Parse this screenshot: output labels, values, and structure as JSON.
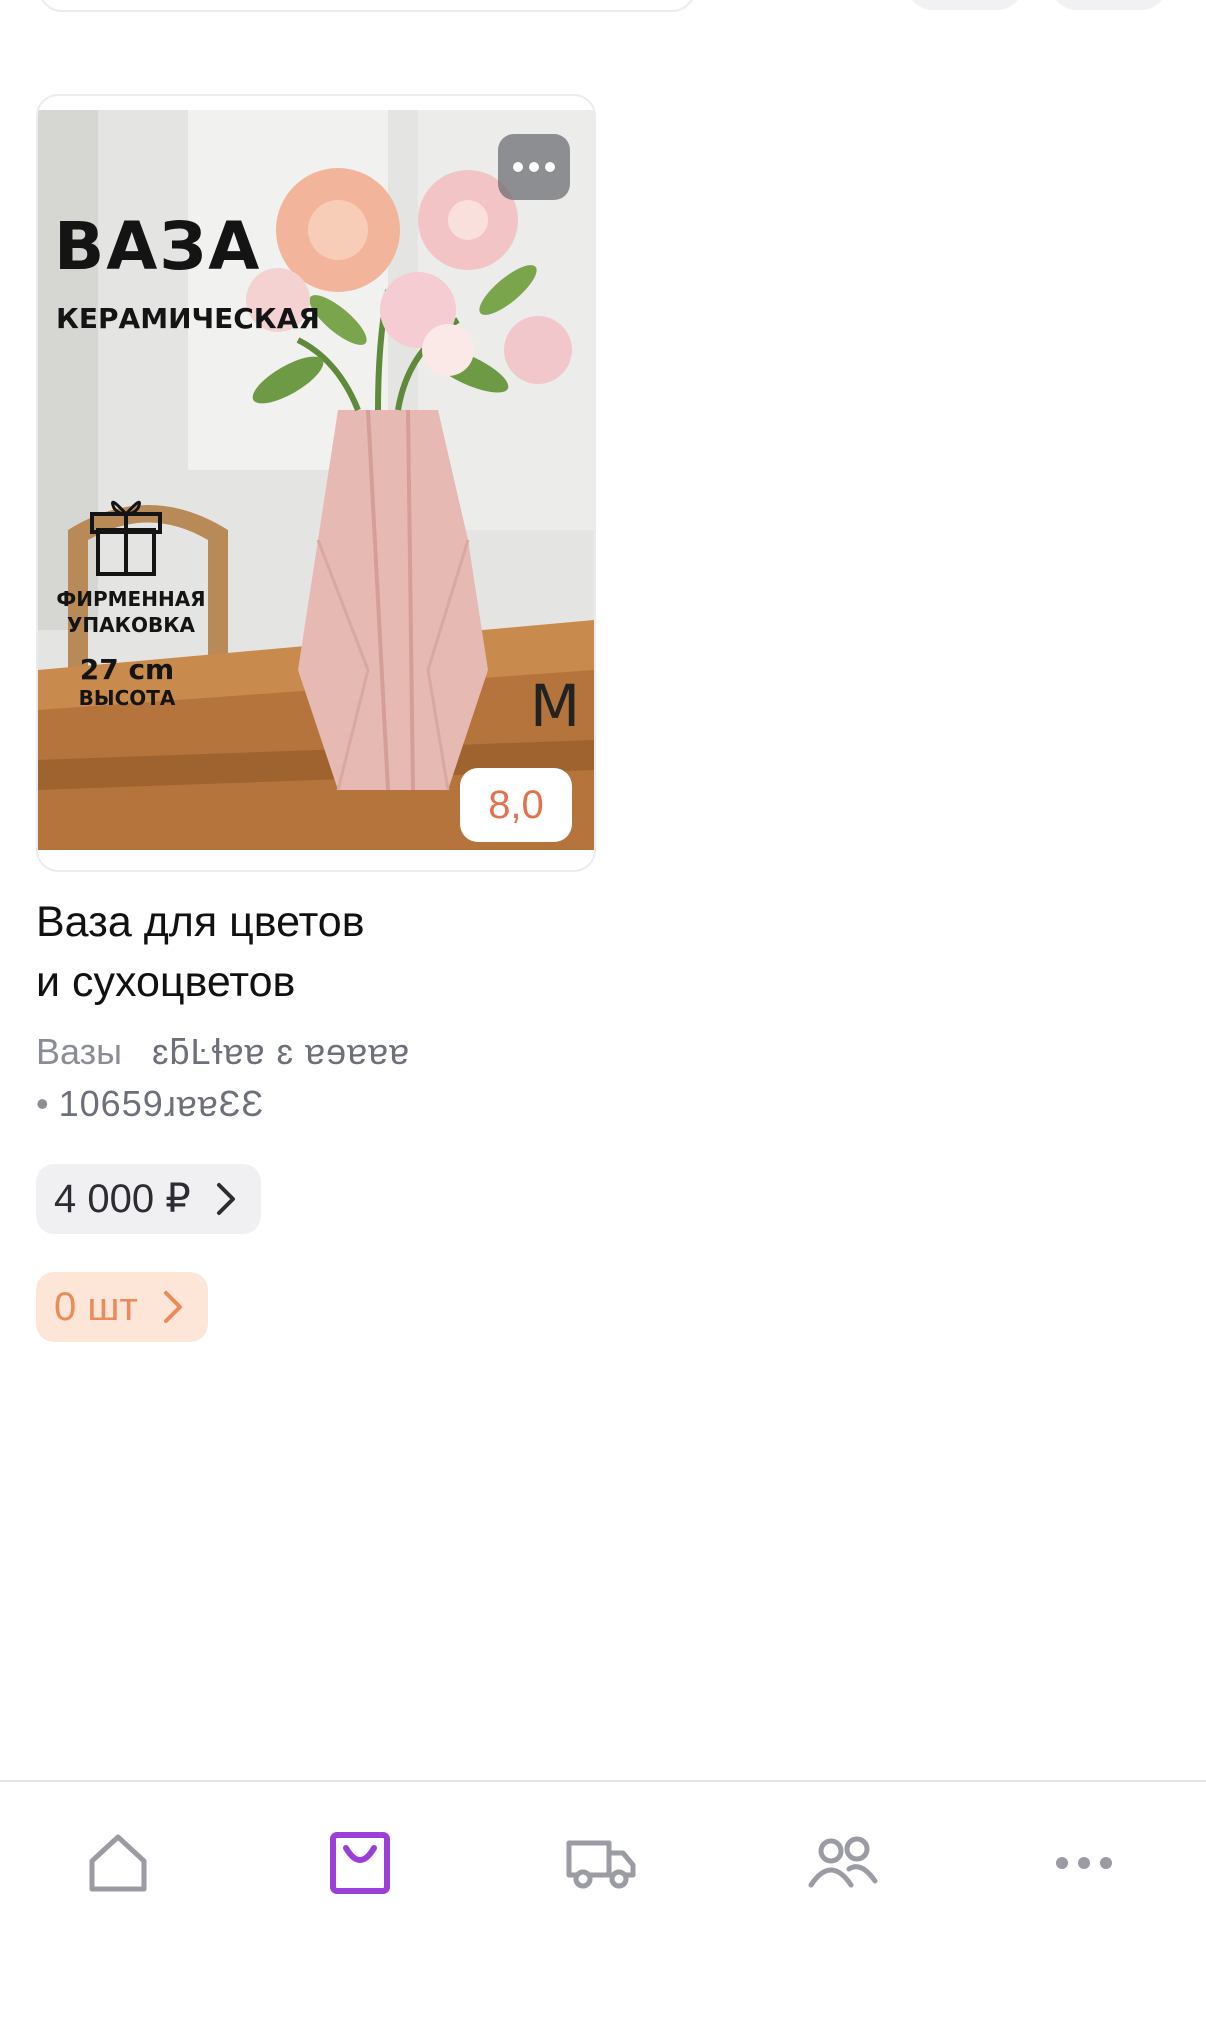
{
  "product": {
    "title_line1": "Ваза для цветов",
    "title_line2": "и сухоцветов",
    "category": "Вазы",
    "seller_obscured": "ɛƃĿɬɐɐ ɛ ɐɘɐɐɐ",
    "article_bullet": "•",
    "article": "10659ɹɐɐƐƐ",
    "price": "4 000 ₽",
    "quantity": "0 шт",
    "rating": "8,0",
    "image_text": {
      "title": "ВАЗА",
      "subtitle": "КЕРАМИЧЕСКАЯ",
      "packaging_line1": "ФИРМЕННАЯ",
      "packaging_line2": "УПАКОВКА",
      "height_value": "27 cm",
      "height_label": "ВЫСОТА",
      "brand": "M"
    }
  },
  "bottom_nav": {
    "items": [
      {
        "icon": "home-icon",
        "active": false
      },
      {
        "icon": "shopping-bag-icon",
        "active": true
      },
      {
        "icon": "truck-icon",
        "active": false
      },
      {
        "icon": "people-icon",
        "active": false
      },
      {
        "icon": "more-icon",
        "active": false
      }
    ]
  },
  "colors": {
    "accent": "#9b3fd9",
    "icon_inactive": "#9a9ba3",
    "rating": "#e2724c",
    "qty_bg": "#fde6d7",
    "qty_text": "#ec8a5a"
  }
}
